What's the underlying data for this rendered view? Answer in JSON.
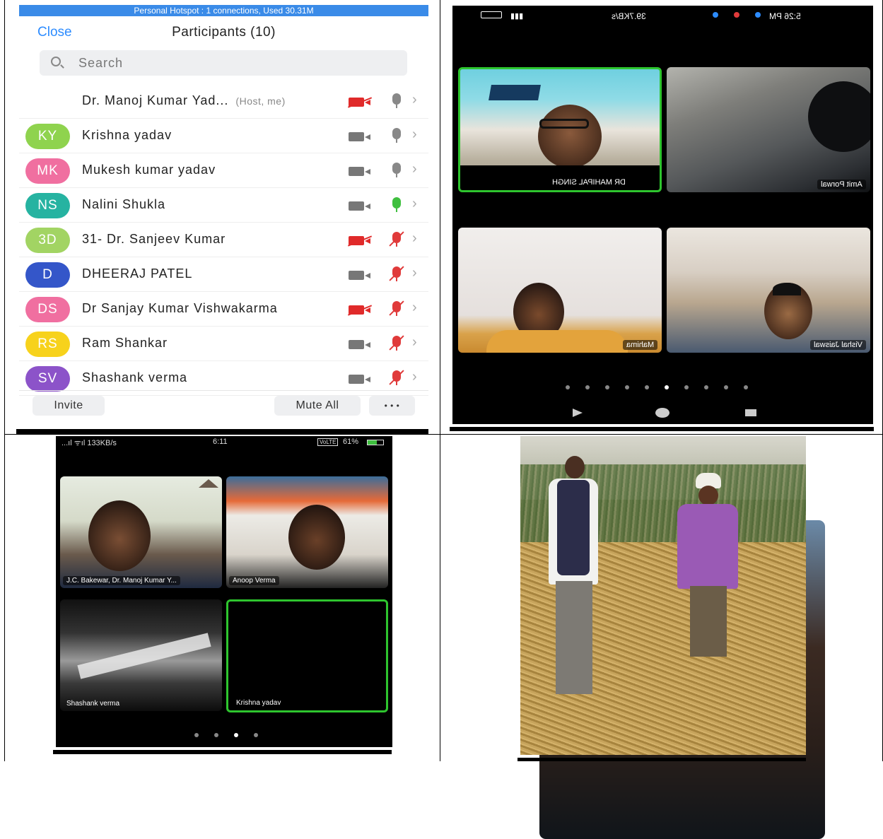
{
  "participants_panel": {
    "hotspot_banner": "Personal Hotspot : 1 connections, Used 30.31M",
    "close_label": "Close",
    "title": "Participants (10)",
    "search_placeholder": "Search",
    "rows": [
      {
        "initials": "",
        "avatar": "photo",
        "name": "Dr. Manoj Kumar Yad...",
        "tag": "(Host, me)",
        "video": "off",
        "audio": "idle"
      },
      {
        "initials": "KY",
        "avatar_color": "#8fd34e",
        "name": "Krishna yadav",
        "tag": "",
        "video": "on",
        "audio": "idle"
      },
      {
        "initials": "MK",
        "avatar_color": "#f06fa0",
        "name": "Mukesh kumar yadav",
        "tag": "",
        "video": "on",
        "audio": "idle"
      },
      {
        "initials": "NS",
        "avatar_color": "#26b3a1",
        "name": "Nalini Shukla",
        "tag": "",
        "video": "on",
        "audio": "live"
      },
      {
        "initials": "3D",
        "avatar_color": "#a2d463",
        "name": "31- Dr. Sanjeev  Kumar",
        "tag": "",
        "video": "off",
        "audio": "muted"
      },
      {
        "initials": "D",
        "avatar_color": "#3456c9",
        "name": "DHEERAJ PATEL",
        "tag": "",
        "video": "on",
        "audio": "muted"
      },
      {
        "initials": "DS",
        "avatar_color": "#f06fa0",
        "name": "Dr Sanjay Kumar Vishwakarma",
        "tag": "",
        "video": "off",
        "audio": "muted"
      },
      {
        "initials": "RS",
        "avatar_color": "#f7d21c",
        "name": "Ram Shankar",
        "tag": "",
        "video": "on",
        "audio": "muted"
      },
      {
        "initials": "SV",
        "avatar_color": "#8c53c9",
        "name": "Shashank verma",
        "tag": "",
        "video": "on",
        "audio": "muted"
      }
    ],
    "invite_label": "Invite",
    "mute_all_label": "Mute All",
    "more_label": "• • •"
  },
  "gallery_top_right": {
    "status_time": "5:26 PM",
    "status_speed": "39.7KB/s",
    "tiles": [
      {
        "name": "DR MAHIPAL SINGH",
        "active": true
      },
      {
        "name": "Amit Porwal",
        "active": false
      },
      {
        "name": "Mahima",
        "active": false
      },
      {
        "name": "Vishal Jaiswal",
        "active": false
      }
    ],
    "page_dots": 10,
    "active_dot": 6
  },
  "gallery_bottom_left": {
    "status_left": "...ıl ᯤıl 133KB/s",
    "status_time": "6:11",
    "status_battery": "61%",
    "status_volte": "VoLTE",
    "tiles": [
      {
        "name": "J.C. Bakewar, Dr. Manoj Kumar Y...",
        "active": false
      },
      {
        "name": "Anoop Verma",
        "active": false
      },
      {
        "name": "Shashank verma",
        "active": false
      },
      {
        "name": "Krishna yadav",
        "active": true
      }
    ],
    "page_dots": 4,
    "active_dot": 3
  },
  "colors": {
    "accent": "#2d8cff",
    "active_border": "#2ec52e",
    "muted_red": "#e02a2a",
    "live_green": "#3fbf3f"
  }
}
